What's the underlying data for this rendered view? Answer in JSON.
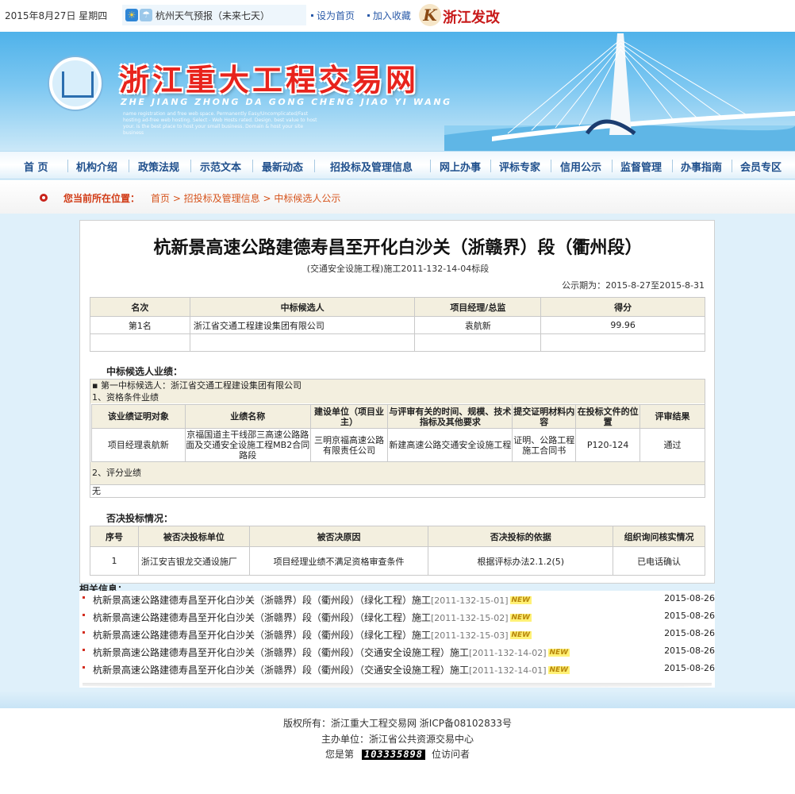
{
  "topbar": {
    "date": "2015年8月27日 星期四",
    "weather_label": "杭州天气预报（未来七天）",
    "link_homepage": "设为首页",
    "link_favorite": "加入收藏",
    "fg_logo_mark": "K",
    "fg_logo_text": "浙江发改"
  },
  "banner": {
    "title": "浙江重大工程交易网",
    "pinyin": "ZHE JIANG ZHONG DA GONG CHENG JIAO YI WANG",
    "tagline": "name registration and free web space. Permanently Easy/Uncomplicated/Fast hosting ad-free web hosting. Select - Web Hosts rated. Design. best value to host your. is the best place to host your small business. Domain & host your site business"
  },
  "nav": {
    "items": [
      "首 页",
      "机构介绍",
      "政策法规",
      "示范文本",
      "最新动态",
      "招投标及管理信息",
      "网上办事",
      "评标专家",
      "信用公示",
      "监督管理",
      "办事指南",
      "会员专区"
    ]
  },
  "breadcrumb": {
    "label": "您当前所在位置：",
    "path": "首页 > 招投标及管理信息 > 中标候选人公示"
  },
  "notice": {
    "title": "杭新景高速公路建德寿昌至开化白沙关（浙赣界）段（衢州段）",
    "subtitle": "(交通安全设施工程)施工2011-132-14-04标段",
    "period": "公示期为：2015-8-27至2015-8-31",
    "candidates_headers": [
      "名次",
      "中标候选人",
      "项目经理/总监",
      "得分"
    ],
    "candidates_rows": [
      [
        "第1名",
        "浙江省交通工程建设集团有限公司",
        "袁航新",
        "99.96"
      ],
      [
        "",
        "",
        "",
        ""
      ]
    ],
    "performance_label": "中标候选人业绩：",
    "first_candidate": "▪ 第一中标候选人：浙江省交通工程建设集团有限公司",
    "qualification_label": "1、资格条件业绩",
    "perf_headers": [
      "该业绩证明对象",
      "业绩名称",
      "建设单位（项目业主）",
      "与评审有关的时间、规模、技术指标及其他要求",
      "提交证明材料内容",
      "在投标文件的位置",
      "评审结果"
    ],
    "perf_rows": [
      [
        "项目经理袁航新",
        "京福国道主干线邵三高速公路路面及交通安全设施工程MB2合同路段",
        "三明京福高速公路有限责任公司",
        "新建高速公路交通安全设施工程",
        "证明、公路工程施工合同书",
        "P120-124",
        "通过"
      ]
    ],
    "scoring_label": "2、评分业绩",
    "scoring_value": "无",
    "rejection_label": "否决投标情况：",
    "rejection_headers": [
      "序号",
      "被否决投标单位",
      "被否决原因",
      "否决投标的依据",
      "组织询问核实情况"
    ],
    "rejection_rows": [
      [
        "1",
        "浙江安吉银龙交通设施厂",
        "项目经理业绩不满足资格审查条件",
        "根据评标办法2.1.2(5)",
        "已电话确认"
      ]
    ]
  },
  "related": {
    "label": "相关信息：",
    "new_badge": "NEW",
    "items": [
      {
        "text": "杭新景高速公路建德寿昌至开化白沙关（浙赣界）段（衢州段）（绿化工程）施工",
        "code": "[2011-132-15-01]",
        "date": "2015-08-26"
      },
      {
        "text": "杭新景高速公路建德寿昌至开化白沙关（浙赣界）段（衢州段）（绿化工程）施工",
        "code": "[2011-132-15-02]",
        "date": "2015-08-26"
      },
      {
        "text": "杭新景高速公路建德寿昌至开化白沙关（浙赣界）段（衢州段）（绿化工程）施工",
        "code": "[2011-132-15-03]",
        "date": "2015-08-26"
      },
      {
        "text": "杭新景高速公路建德寿昌至开化白沙关（浙赣界）段（衢州段）（交通安全设施工程）施工",
        "code": "[2011-132-14-02]",
        "date": "2015-08-26"
      },
      {
        "text": "杭新景高速公路建德寿昌至开化白沙关（浙赣界）段（衢州段）（交通安全设施工程）施工",
        "code": "[2011-132-14-01]",
        "date": "2015-08-26"
      }
    ]
  },
  "footer": {
    "copyright": "版权所有：浙江重大工程交易网 浙ICP备08102833号",
    "host": "主办单位：浙江省公共资源交易中心",
    "visitor_prefix": "您是第",
    "visitor_count": "103335898",
    "visitor_suffix": "位访问者"
  },
  "colors": {
    "accent_red": "#c8231b",
    "nav_blue": "#1f4f8c",
    "table_header_bg": "#f3efdf",
    "page_bg": "#dff0fa"
  },
  "icons": [
    "weather-sun-icon",
    "weather-rain-icon",
    "emblem-icon",
    "breadcrumb-bullet-icon",
    "new-badge-icon"
  ]
}
